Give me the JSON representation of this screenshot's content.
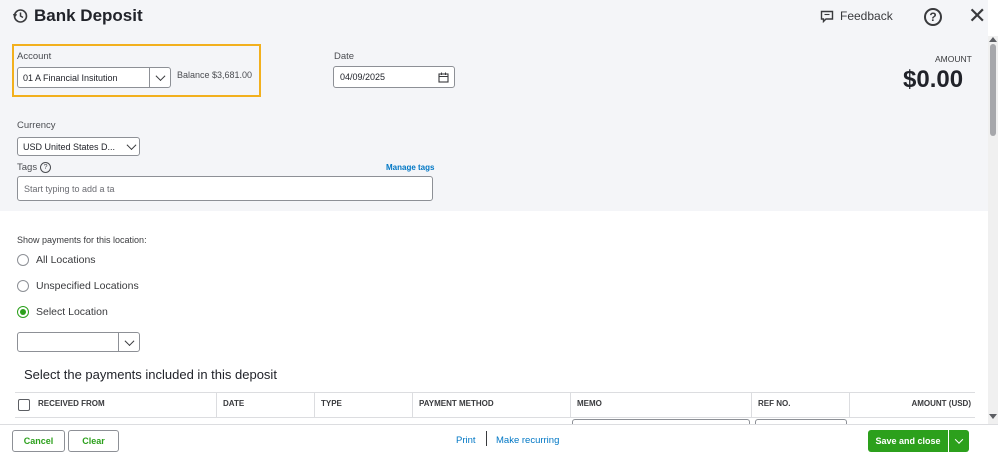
{
  "header": {
    "title": "Bank Deposit",
    "feedback_label": "Feedback",
    "help_glyph": "?",
    "close_glyph": "✕"
  },
  "account": {
    "label": "Account",
    "value": "01 A Financial Insitution",
    "balance": "Balance $3,681.00"
  },
  "date": {
    "label": "Date",
    "value": "04/09/2025"
  },
  "amount": {
    "label": "AMOUNT",
    "value": "$0.00"
  },
  "currency": {
    "label": "Currency",
    "value": "USD United States D..."
  },
  "tags": {
    "label": "Tags",
    "manage_label": "Manage tags",
    "placeholder": "Start typing to add a ta"
  },
  "location": {
    "prompt": "Show payments for this location:",
    "options": [
      "All Locations",
      "Unspecified Locations",
      "Select Location"
    ],
    "selected_index": 2,
    "select_value": ""
  },
  "payments": {
    "title": "Select the payments included in this deposit",
    "columns": [
      "RECEIVED FROM",
      "DATE",
      "TYPE",
      "PAYMENT METHOD",
      "MEMO",
      "REF NO.",
      "AMOUNT (USD)"
    ]
  },
  "footer": {
    "cancel_label": "Cancel",
    "clear_label": "Clear",
    "print_label": "Print",
    "make_recurring_label": "Make recurring",
    "save_close_label": "Save and close"
  },
  "colors": {
    "accent_green": "#2ca01c",
    "link_blue": "#0077c5",
    "highlight_yellow": "#f2b01e"
  }
}
